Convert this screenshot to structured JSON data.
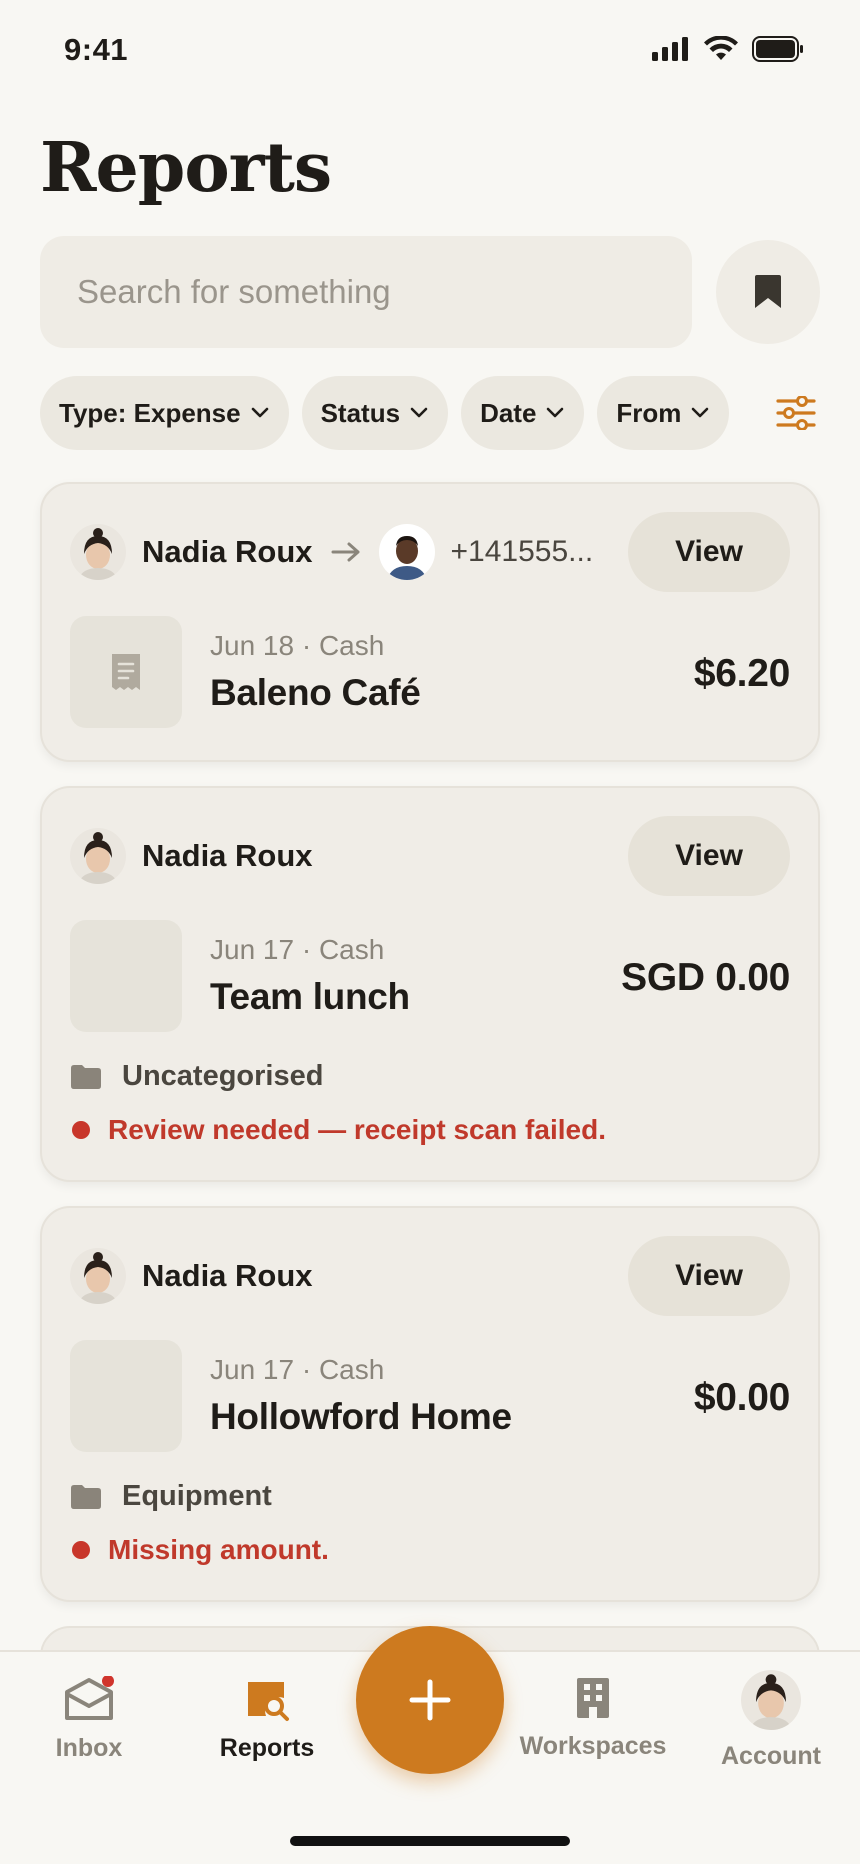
{
  "status_bar": {
    "time": "9:41"
  },
  "page": {
    "title": "Reports"
  },
  "search": {
    "placeholder": "Search for something",
    "value": ""
  },
  "filters": [
    {
      "label": "Type: Expense"
    },
    {
      "label": "Status"
    },
    {
      "label": "Date"
    },
    {
      "label": "From"
    }
  ],
  "reports": [
    {
      "sender": "Nadia Roux",
      "recipient": "+141555...",
      "view_label": "View",
      "meta": "Jun 18 · Cash",
      "merchant": "Baleno Café",
      "amount": "$6.20"
    },
    {
      "sender": "Nadia Roux",
      "view_label": "View",
      "meta": "Jun 17 · Cash",
      "merchant": "Team lunch",
      "amount": "SGD 0.00",
      "category": "Uncategorised",
      "alert": "Review needed — receipt scan failed."
    },
    {
      "sender": "Nadia Roux",
      "view_label": "View",
      "meta": "Jun 17 · Cash",
      "merchant": "Hollowford Home",
      "amount": "$0.00",
      "category": "Equipment",
      "alert": "Missing amount."
    }
  ],
  "tab_bar": {
    "tabs": [
      {
        "label": "Inbox",
        "icon": "inbox-icon",
        "badge": true
      },
      {
        "label": "Reports",
        "icon": "reports-icon",
        "active": true
      },
      {
        "label": "Workspaces",
        "icon": "building-icon"
      },
      {
        "label": "Account",
        "icon": "avatar"
      }
    ]
  },
  "colors": {
    "accent": "#cd7a1f",
    "alert": "#c0392b",
    "background": "#f8f7f3",
    "card": "#f0ede7"
  }
}
